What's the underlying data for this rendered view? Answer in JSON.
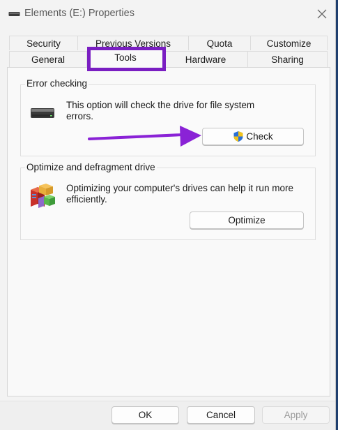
{
  "window": {
    "title": "Elements (E:) Properties",
    "title_icon": "drive-icon",
    "close_icon": "close-icon"
  },
  "tabs": {
    "row1": [
      "Security",
      "Previous Versions",
      "Quota",
      "Customize"
    ],
    "row2": [
      "General",
      "Tools",
      "Hardware",
      "Sharing"
    ],
    "active": "Tools"
  },
  "error_checking": {
    "label": "Error checking",
    "description_line1": "This option will check the drive for file system",
    "description_line2": "errors.",
    "icon": "hard-drive-icon",
    "button_label": "Check",
    "button_icon": "uac-shield-icon"
  },
  "optimize": {
    "label": "Optimize and defragment drive",
    "description_line1": "Optimizing your computer's drives can help it run more",
    "description_line2": "efficiently.",
    "icon": "defrag-icon",
    "button_label": "Optimize"
  },
  "footer": {
    "ok_label": "OK",
    "cancel_label": "Cancel",
    "apply_label": "Apply"
  },
  "colors": {
    "annotation": "#7a1ec2",
    "arrow": "#8a22d6",
    "window_bg": "#f3f3f3"
  }
}
